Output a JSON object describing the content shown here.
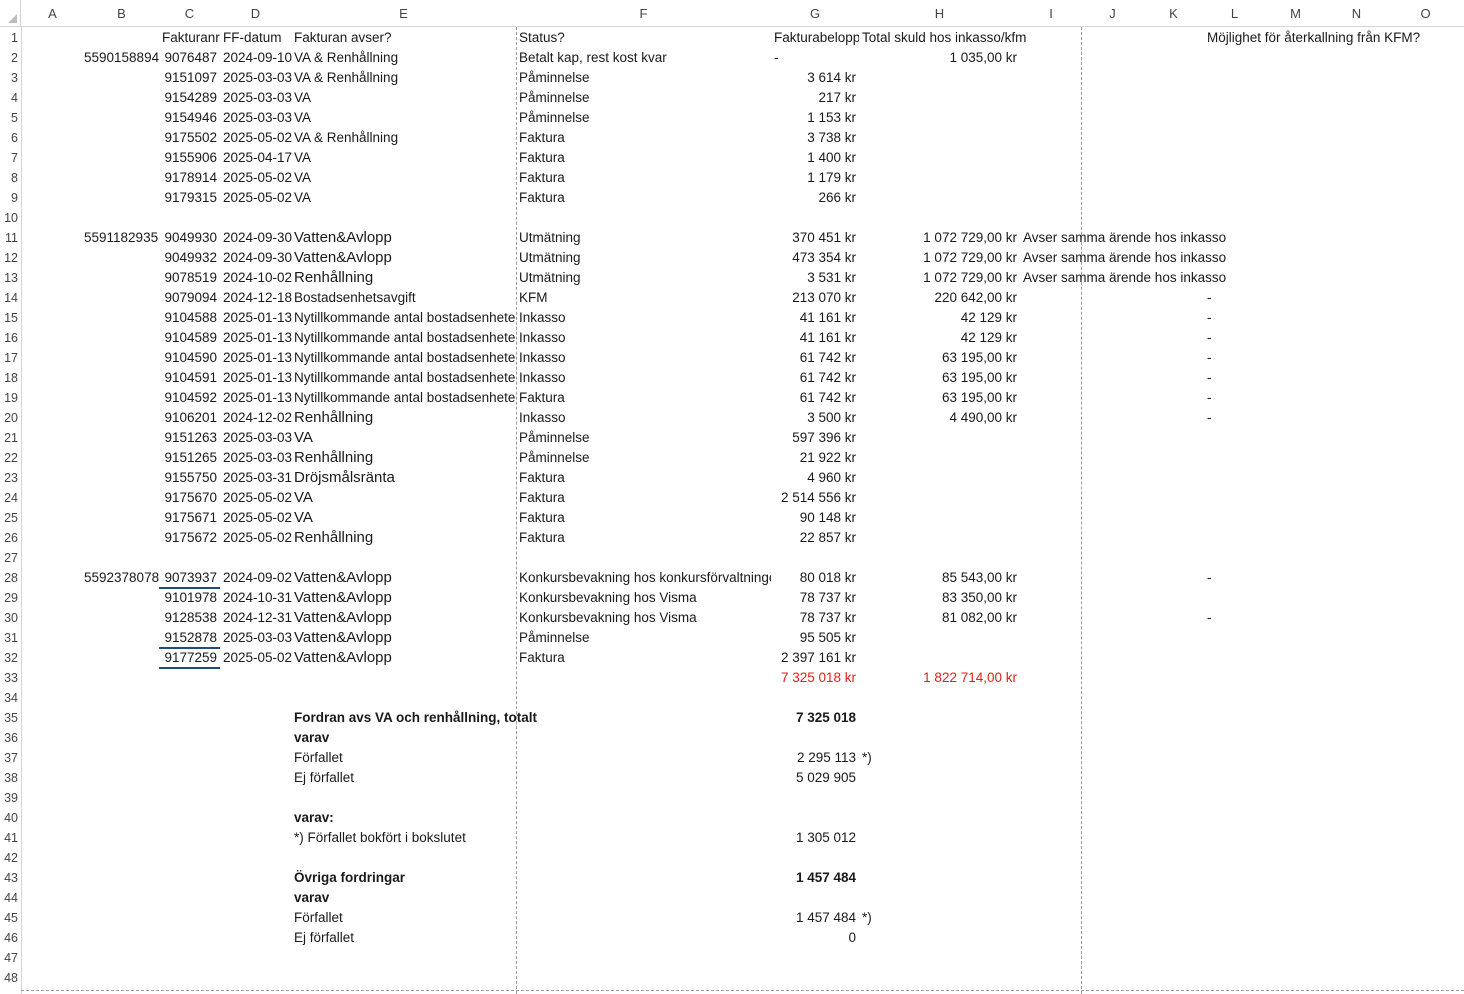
{
  "columns": [
    "A",
    "B",
    "C",
    "D",
    "E",
    "F",
    "G",
    "H",
    "I",
    "J",
    "K",
    "L",
    "M",
    "N",
    "O"
  ],
  "row_numbers": [
    "1",
    "2",
    "3",
    "4",
    "5",
    "6",
    "7",
    "8",
    "9",
    "10",
    "11",
    "12",
    "13",
    "14",
    "15",
    "16",
    "17",
    "18",
    "19",
    "20",
    "21",
    "22",
    "23",
    "24",
    "25",
    "26",
    "27",
    "28",
    "29",
    "30",
    "31",
    "32",
    "33",
    "34",
    "35",
    "36",
    "37",
    "38",
    "39",
    "40",
    "41",
    "42",
    "43",
    "44",
    "45",
    "46",
    "47",
    "48"
  ],
  "headers": {
    "C": "Fakturanr",
    "D": "FF-datum",
    "E": "Fakturan avser?",
    "F": "Status?",
    "G": "Fakturabelopp",
    "H": "Total skuld hos inkasso/kfm",
    "L": "Möjlighet för återkallning från KFM?"
  },
  "customers": [
    {
      "row": 2,
      "id": "5590158894"
    },
    {
      "row": 11,
      "id": "5591182935"
    },
    {
      "row": 28,
      "id": "5592378078"
    }
  ],
  "rows": [
    {
      "row": 2,
      "nr": "9076487",
      "date": "2024-09-10",
      "avser": "VA & Renhållning",
      "status": "Betalt kap, rest kost kvar",
      "belopp": "-",
      "skuld": "1 035,00 kr"
    },
    {
      "row": 3,
      "nr": "9151097",
      "date": "2025-03-03",
      "avser": "VA & Renhållning",
      "status": "Påminnelse",
      "belopp": "3 614 kr"
    },
    {
      "row": 4,
      "nr": "9154289",
      "date": "2025-03-03",
      "avser": "VA",
      "status": "Påminnelse",
      "belopp": "217 kr"
    },
    {
      "row": 5,
      "nr": "9154946",
      "date": "2025-03-03",
      "avser": "VA",
      "status": "Påminnelse",
      "belopp": "1 153 kr"
    },
    {
      "row": 6,
      "nr": "9175502",
      "date": "2025-05-02",
      "avser": "VA & Renhållning",
      "status": "Faktura",
      "belopp": "3 738 kr"
    },
    {
      "row": 7,
      "nr": "9155906",
      "date": "2025-04-17",
      "avser": "VA",
      "status": "Faktura",
      "belopp": "1 400 kr"
    },
    {
      "row": 8,
      "nr": "9178914",
      "date": "2025-05-02",
      "avser": "VA",
      "status": "Faktura",
      "belopp": "1 179 kr"
    },
    {
      "row": 9,
      "nr": "9179315",
      "date": "2025-05-02",
      "avser": "VA",
      "status": "Faktura",
      "belopp": "266 kr"
    },
    {
      "row": 11,
      "nr": "9049930",
      "date": "2024-09-30",
      "avser": "Vatten&Avlopp",
      "big": true,
      "status": "Utmätning",
      "belopp": "370 451 kr",
      "skuld": "1 072 729,00 kr",
      "note": "Avser samma ärende hos inkasso"
    },
    {
      "row": 12,
      "nr": "9049932",
      "date": "2024-09-30",
      "avser": "Vatten&Avlopp",
      "big": true,
      "status": "Utmätning",
      "belopp": "473 354 kr",
      "skuld": "1 072 729,00 kr",
      "note": "Avser samma ärende hos inkasso"
    },
    {
      "row": 13,
      "nr": "9078519",
      "date": "2024-10-02",
      "avser": "Renhållning",
      "big": true,
      "status": "Utmätning",
      "belopp": "3 531 kr",
      "skuld": "1 072 729,00 kr",
      "note": "Avser samma ärende hos inkasso"
    },
    {
      "row": 14,
      "nr": "9079094",
      "date": "2024-12-18",
      "avser": "Bostadsenhetsavgift",
      "status": "KFM",
      "belopp": "213 070 kr",
      "skuld": "220 642,00 kr",
      "kfm": "-"
    },
    {
      "row": 15,
      "nr": "9104588",
      "date": "2025-01-13",
      "avser": "Nytillkommande antal bostadsenheter",
      "status": "Inkasso",
      "belopp": "41 161 kr",
      "skuld": "42 129 kr",
      "kfm": "-"
    },
    {
      "row": 16,
      "nr": "9104589",
      "date": "2025-01-13",
      "avser": "Nytillkommande antal bostadsenheter",
      "status": "Inkasso",
      "belopp": "41 161 kr",
      "skuld": "42 129 kr",
      "kfm": "-"
    },
    {
      "row": 17,
      "nr": "9104590",
      "date": "2025-01-13",
      "avser": "Nytillkommande antal bostadsenheter",
      "status": "Inkasso",
      "belopp": "61 742 kr",
      "skuld": "63 195,00 kr",
      "kfm": "-"
    },
    {
      "row": 18,
      "nr": "9104591",
      "date": "2025-01-13",
      "avser": "Nytillkommande antal bostadsenheter",
      "status": "Inkasso",
      "belopp": "61 742 kr",
      "skuld": "63 195,00 kr",
      "kfm": "-"
    },
    {
      "row": 19,
      "nr": "9104592",
      "date": "2025-01-13",
      "avser": "Nytillkommande antal bostadsenheter",
      "status": "Faktura",
      "belopp": "61 742 kr",
      "skuld": "63 195,00 kr",
      "kfm": "-"
    },
    {
      "row": 20,
      "nr": "9106201",
      "date": "2024-12-02",
      "avser": "Renhållning",
      "big": true,
      "status": "Inkasso",
      "belopp": "3 500 kr",
      "skuld": "4 490,00 kr",
      "kfm": "-"
    },
    {
      "row": 21,
      "nr": "9151263",
      "date": "2025-03-03",
      "avser": "VA",
      "big": true,
      "status": "Påminnelse",
      "belopp": "597 396 kr"
    },
    {
      "row": 22,
      "nr": "9151265",
      "date": "2025-03-03",
      "avser": "Renhållning",
      "big": true,
      "status": "Påminnelse",
      "belopp": "21 922 kr"
    },
    {
      "row": 23,
      "nr": "9155750",
      "date": "2025-03-31",
      "avser": "Dröjsmålsränta",
      "big": true,
      "status": "Faktura",
      "belopp": "4 960 kr"
    },
    {
      "row": 24,
      "nr": "9175670",
      "date": "2025-05-02",
      "avser": "VA",
      "big": true,
      "status": "Faktura",
      "belopp": "2 514 556 kr"
    },
    {
      "row": 25,
      "nr": "9175671",
      "date": "2025-05-02",
      "avser": "VA",
      "big": true,
      "status": "Faktura",
      "belopp": "90 148 kr"
    },
    {
      "row": 26,
      "nr": "9175672",
      "date": "2025-05-02",
      "avser": "Renhållning",
      "big": true,
      "status": "Faktura",
      "belopp": "22 857 kr"
    },
    {
      "row": 28,
      "nr": "9073937",
      "date": "2024-09-02",
      "avser": "Vatten&Avlopp",
      "big": true,
      "status": "Konkursbevakning hos konkursförvaltningen",
      "belopp": "80 018 kr",
      "skuld": "85 543,00 kr",
      "kfm": "-"
    },
    {
      "row": 29,
      "nr": "9101978",
      "date": "2024-10-31",
      "avser": "Vatten&Avlopp",
      "big": true,
      "status": "Konkursbevakning hos Visma",
      "belopp": "78 737 kr",
      "skuld": "83 350,00 kr"
    },
    {
      "row": 30,
      "nr": "9128538",
      "date": "2024-12-31",
      "avser": "Vatten&Avlopp",
      "big": true,
      "status": "Konkursbevakning hos Visma",
      "belopp": "78 737 kr",
      "skuld": "81 082,00 kr",
      "kfm": "-"
    },
    {
      "row": 31,
      "nr": "9152878",
      "date": "2025-03-03",
      "avser": "Vatten&Avlopp",
      "big": true,
      "status": "Påminnelse",
      "belopp": "95 505 kr"
    },
    {
      "row": 32,
      "nr": "9177259",
      "date": "2025-05-02",
      "avser": "Vatten&Avlopp",
      "big": true,
      "status": "Faktura",
      "belopp": "2 397 161 kr"
    }
  ],
  "totals": {
    "belopp": "7 325 018 kr",
    "skuld": "1 822 714,00 kr"
  },
  "summary": [
    {
      "row": 35,
      "label": "Fordran avs VA och renhållning, totalt",
      "value": "7 325 018",
      "bold": true
    },
    {
      "row": 36,
      "label": "varav",
      "bold": true
    },
    {
      "row": 37,
      "label": "Förfallet",
      "value": "2 295 113",
      "mark": "*)"
    },
    {
      "row": 38,
      "label": "Ej förfallet",
      "value": "5 029 905"
    },
    {
      "row": 40,
      "label": "varav:",
      "bold": true
    },
    {
      "row": 41,
      "label": "*) Förfallet bokfört i bokslutet",
      "value": "1 305 012"
    },
    {
      "row": 43,
      "label": "Övriga fordringar",
      "value": "1 457 484",
      "bold": true
    },
    {
      "row": 44,
      "label": "varav",
      "bold": true
    },
    {
      "row": 45,
      "label": "Förfallet",
      "value": "1 457 484",
      "mark": "*)"
    },
    {
      "row": 46,
      "label": "Ej förfallet",
      "value": "0"
    }
  ],
  "colors": {
    "red": "#e0201b",
    "underline": "#1f4e79"
  }
}
